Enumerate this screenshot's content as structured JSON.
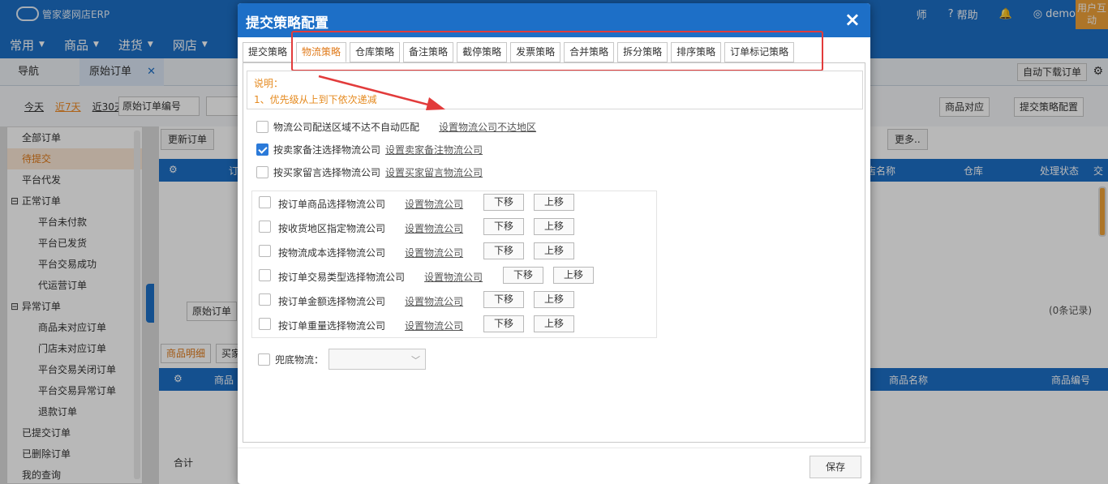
{
  "app": {
    "logo_text": "管家婆网店ERP",
    "nav": [
      "常用",
      "商品",
      "进货",
      "网店"
    ],
    "top_right": {
      "teacher": "师",
      "help": "帮助",
      "user": "demo",
      "user_interact": "用户互动"
    }
  },
  "tabs": {
    "nav": "导航",
    "original_orders": "原始订单",
    "auto_download": "自动下载订单"
  },
  "filter": {
    "today": "今天",
    "last7": "近7天",
    "last30": "近30天",
    "field_select": "原始订单编号",
    "goods_match": "商品对应",
    "submit_config": "提交策略配置"
  },
  "sidebar": {
    "items": [
      {
        "label": "全部订单"
      },
      {
        "label": "待提交"
      },
      {
        "label": "平台代发"
      },
      {
        "label": "正常订单"
      },
      {
        "label": "平台未付款"
      },
      {
        "label": "平台已发货"
      },
      {
        "label": "平台交易成功"
      },
      {
        "label": "代运营订单"
      },
      {
        "label": "异常订单"
      },
      {
        "label": "商品未对应订单"
      },
      {
        "label": "门店未对应订单"
      },
      {
        "label": "平台交易关闭订单"
      },
      {
        "label": "平台交易异常订单"
      },
      {
        "label": "退款订单"
      },
      {
        "label": "已提交订单"
      },
      {
        "label": "已删除订单"
      },
      {
        "label": "我的查询"
      }
    ]
  },
  "content": {
    "refresh": "更新订单",
    "more": "更多..",
    "cols_top": {
      "order_col": "订",
      "shop_name": "店名称",
      "warehouse": "仓库",
      "process_status": "处理状态",
      "trade": "交"
    },
    "bottom_tab": "原始订单",
    "records": "(0条记录)",
    "detail_tab": "商品明细",
    "buyer_tab": "买家",
    "cols_bottom": {
      "goods": "商品",
      "goods_name": "商品名称",
      "goods_code": "商品编号"
    },
    "total": "合计"
  },
  "modal": {
    "title": "提交策略配置",
    "close": "×",
    "tabs": [
      {
        "label": "提交策略"
      },
      {
        "label": "物流策略",
        "active": true
      },
      {
        "label": "仓库策略"
      },
      {
        "label": "备注策略"
      },
      {
        "label": "截停策略"
      },
      {
        "label": "发票策略"
      },
      {
        "label": "合并策略"
      },
      {
        "label": "拆分策略"
      },
      {
        "label": "排序策略"
      },
      {
        "label": "订单标记策略"
      }
    ],
    "note_title": "说明：",
    "note_line": "1、优先级从上到下依次递减",
    "options": [
      {
        "label": "物流公司配送区域不达不自动匹配",
        "link": "设置物流公司不达地区",
        "checked": false
      },
      {
        "label": "按卖家备注选择物流公司",
        "link": "设置卖家备注物流公司",
        "checked": true
      },
      {
        "label": "按买家留言选择物流公司",
        "link": "设置买家留言物流公司",
        "checked": false
      }
    ],
    "priority": [
      {
        "label": "按订单商品选择物流公司",
        "link": "设置物流公司"
      },
      {
        "label": "按收货地区指定物流公司",
        "link": "设置物流公司"
      },
      {
        "label": "按物流成本选择物流公司",
        "link": "设置物流公司"
      },
      {
        "label": "按订单交易类型选择物流公司",
        "link": "设置物流公司"
      },
      {
        "label": "按订单金额选择物流公司",
        "link": "设置物流公司"
      },
      {
        "label": "按订单重量选择物流公司",
        "link": "设置物流公司"
      }
    ],
    "move_down": "下移",
    "move_up": "上移",
    "fallback_label": "兜底物流：",
    "fallback_value": "",
    "save": "保存"
  },
  "colors": {
    "primary": "#1d6fc7",
    "accent_orange": "#e07a1a",
    "highlight_red": "#e23b3b"
  }
}
